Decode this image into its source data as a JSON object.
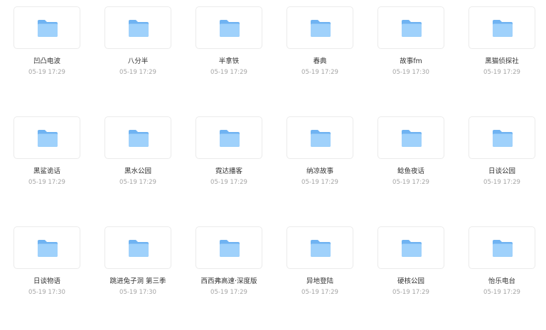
{
  "colors": {
    "folder_back": "#6fb3f2",
    "folder_front": "#9fd1fb",
    "tile_border": "#ebebeb",
    "name_text": "#333333",
    "date_text": "#a5a5a5"
  },
  "icon": "folder-icon",
  "folders": [
    {
      "name": "凹凸电波",
      "date": "05-19 17:29"
    },
    {
      "name": "八分半",
      "date": "05-19 17:29"
    },
    {
      "name": "半拿铁",
      "date": "05-19 17:29"
    },
    {
      "name": "春典",
      "date": "05-19 17:29"
    },
    {
      "name": "故事fm",
      "date": "05-19 17:30"
    },
    {
      "name": "黑猫侦探社",
      "date": "05-19 17:29"
    },
    {
      "name": "黑鲨诡话",
      "date": "05-19 17:29"
    },
    {
      "name": "黑水公园",
      "date": "05-19 17:29"
    },
    {
      "name": "霓达播客",
      "date": "05-19 17:29"
    },
    {
      "name": "纳凉故事",
      "date": "05-19 17:29"
    },
    {
      "name": "鲶鱼夜话",
      "date": "05-19 17:29"
    },
    {
      "name": "日谈公园",
      "date": "05-19 17:29"
    },
    {
      "name": "日谈物语",
      "date": "05-19 17:30"
    },
    {
      "name": "跳进兔子洞 第三季",
      "date": "05-19 17:30"
    },
    {
      "name": "西西弗高速·深度版",
      "date": "05-19 17:29"
    },
    {
      "name": "异地登陆",
      "date": "05-19 17:29"
    },
    {
      "name": "硬核公园",
      "date": "05-19 17:29"
    },
    {
      "name": "怡乐电台",
      "date": "05-19 17:29"
    }
  ]
}
